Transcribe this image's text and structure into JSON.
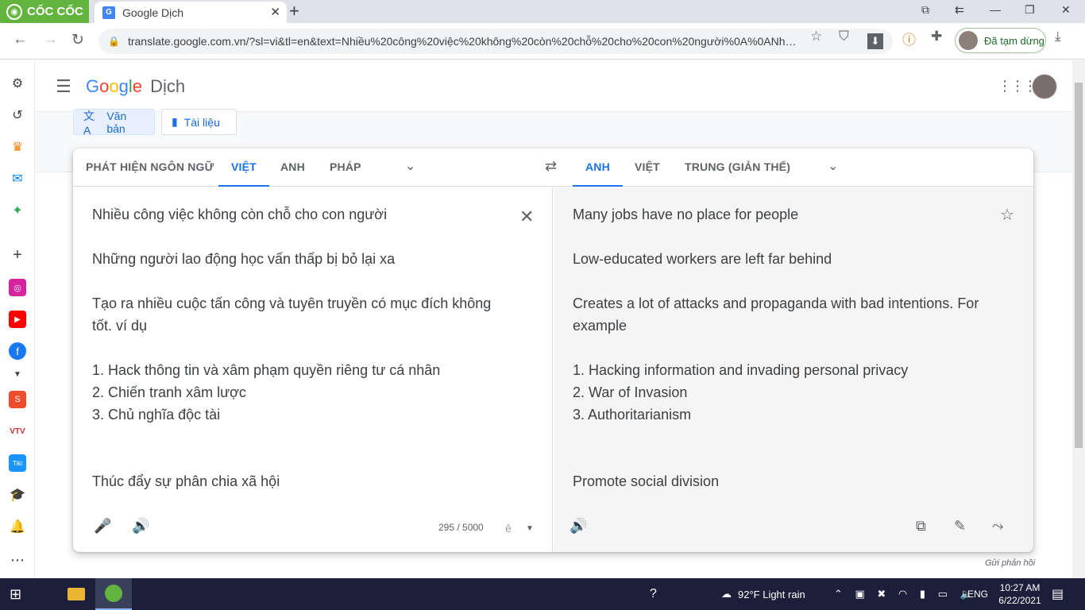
{
  "browser": {
    "brand_name": "CỐC CỐC",
    "tab_title": "Google Dịch",
    "tab_close": "✕",
    "new_tab": "+",
    "url": "translate.google.com.vn/?sl=vi&tl=en&text=Nhiều%20công%20việc%20không%20còn%20chỗ%20cho%20con%20người%0A%0ANhữn...",
    "profile_status": "Đã tạm dừng"
  },
  "header": {
    "logo_parts": [
      "G",
      "o",
      "o",
      "g",
      "l",
      "e"
    ],
    "product": "Dịch"
  },
  "modes": {
    "text_label": "Văn bản",
    "doc_label": "Tài liệu"
  },
  "source_langs": {
    "detect": "PHÁT HIỆN NGÔN NGỮ",
    "items": [
      "VIỆT",
      "ANH",
      "PHÁP"
    ],
    "active": "VIỆT"
  },
  "target_langs": {
    "items": [
      "ANH",
      "VIỆT",
      "TRUNG (GIẢN THỂ)"
    ],
    "active": "ANH"
  },
  "source": {
    "lines": [
      "Nhiều công việc không còn chỗ cho con người",
      "",
      "Những người lao động học vấn thấp bị bỏ lại xa",
      "",
      "Tạo ra nhiều cuộc tấn công và tuyên truyền có mục đích không tốt. ví dụ",
      "",
      "1. Hack thông tin và xâm phạm quyền riêng tư cá nhân",
      "2. Chiến tranh xâm lược",
      "3. Chủ nghĩa độc tài",
      "",
      "",
      "Thúc đẩy sự phân chia xã hội"
    ],
    "counter": "295 / 5000",
    "ime_char": "ê"
  },
  "target": {
    "lines": [
      "Many jobs have no place for people",
      "",
      "Low-educated workers are left far behind",
      "",
      "Creates a lot of attacks and propaganda with bad intentions. For example",
      "",
      "1. Hacking information and invading personal privacy",
      "2. War of Invasion",
      "3. Authoritarianism",
      "",
      "",
      "Promote social division"
    ]
  },
  "feedback": "Gửi phản hồi",
  "taskbar": {
    "weather": "92°F  Light rain",
    "lang": "ENG",
    "time": "10:27 AM",
    "date": "6/22/2021"
  },
  "colors": {
    "accent": "#1a73e8",
    "brand_green": "#63b43f",
    "taskbar": "#1c1f3a"
  }
}
